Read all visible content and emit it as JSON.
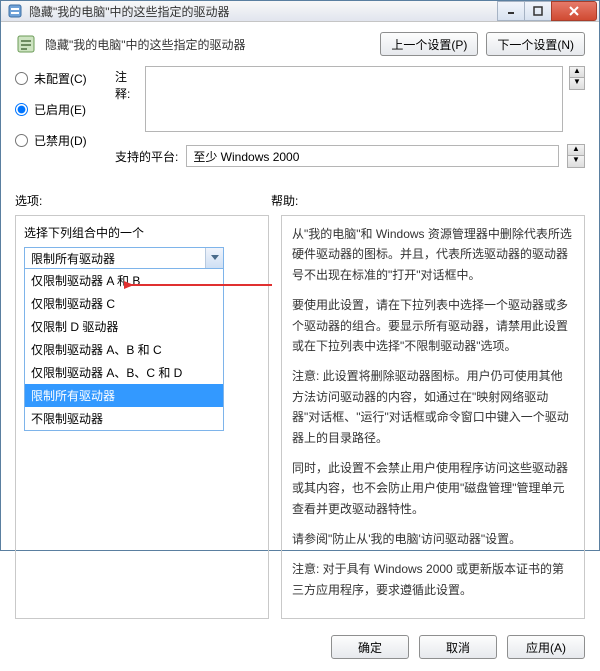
{
  "window": {
    "title": "隐藏\"我的电脑\"中的这些指定的驱动器"
  },
  "header": {
    "text": "隐藏\"我的电脑\"中的这些指定的驱动器",
    "prev": "上一个设置(P)",
    "next": "下一个设置(N)"
  },
  "radios": {
    "unconfigured": "未配置(C)",
    "enabled": "已启用(E)",
    "disabled": "已禁用(D)"
  },
  "form": {
    "comment_label": "注释:",
    "platform_label": "支持的平台:",
    "platform_value": "至少 Windows 2000"
  },
  "labels": {
    "options": "选项:",
    "help": "帮助:"
  },
  "combo": {
    "label": "选择下列组合中的一个",
    "value": "限制所有驱动器",
    "items": [
      "仅限制驱动器 A 和 B",
      "仅限制驱动器 C",
      "仅限制 D 驱动器",
      "仅限制驱动器 A、B 和 C",
      "仅限制驱动器 A、B、C 和 D",
      "限制所有驱动器",
      "不限制驱动器"
    ]
  },
  "help": {
    "p1": "从\"我的电脑\"和 Windows 资源管理器中删除代表所选硬件驱动器的图标。并且，代表所选驱动器的驱动器号不出现在标准的\"打开\"对话框中。",
    "p2": "要使用此设置，请在下拉列表中选择一个驱动器或多个驱动器的组合。要显示所有驱动器，请禁用此设置或在下拉列表中选择\"不限制驱动器\"选项。",
    "p3": "注意: 此设置将删除驱动器图标。用户仍可使用其他方法访问驱动器的内容，如通过在\"映射网络驱动器\"对话框、\"运行\"对话框或命令窗口中键入一个驱动器上的目录路径。",
    "p4": "同时，此设置不会禁止用户使用程序访问这些驱动器或其内容，也不会防止用户使用\"磁盘管理\"管理单元查看并更改驱动器特性。",
    "p5": "请参阅\"防止从'我的电脑'访问驱动器\"设置。",
    "p6": "注意: 对于具有 Windows 2000 或更新版本证书的第三方应用程序，要求遵循此设置。"
  },
  "footer": {
    "ok": "确定",
    "cancel": "取消",
    "apply": "应用(A)"
  }
}
